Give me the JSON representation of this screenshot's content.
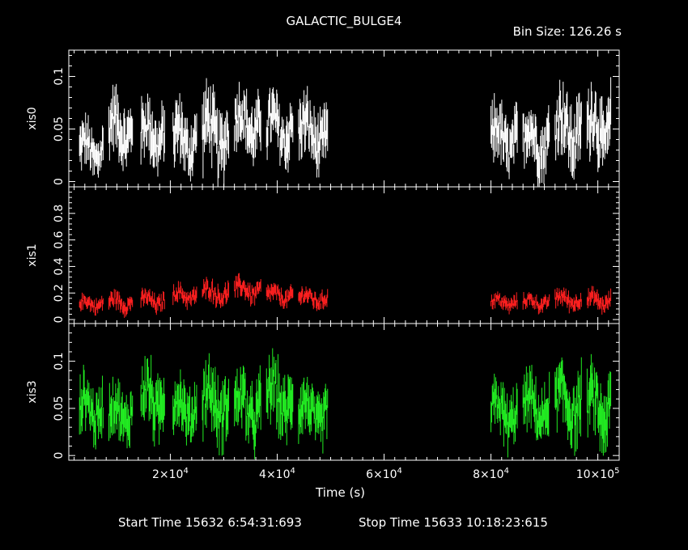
{
  "header": {
    "title": "GALACTIC_BULGE4",
    "bin_size": "Bin Size: 126.26 s"
  },
  "footer": {
    "start_time": "Start Time 15632  6:54:31:693",
    "stop_time": "Stop Time 15633 10:18:23:615"
  },
  "colors": {
    "xis0": "#ffffff",
    "xis1": "#ff2020",
    "xis3": "#22ee22",
    "axis": "#ffffff",
    "background": "#000000"
  },
  "chart_data": {
    "type": "scatter",
    "xlabel": "Time (s)",
    "xlim": [
      1000,
      104000
    ],
    "x_ticks": [
      {
        "value": 20000,
        "mant": "2",
        "exp": "4"
      },
      {
        "value": 40000,
        "mant": "4",
        "exp": "4"
      },
      {
        "value": 60000,
        "mant": "6",
        "exp": "4"
      },
      {
        "value": 80000,
        "mant": "8",
        "exp": "4"
      },
      {
        "value": 100000,
        "mant": "10",
        "exp": "5"
      }
    ],
    "panels": [
      {
        "name": "xis0",
        "ylabel": "xis0",
        "color": "#ffffff",
        "ylim": [
          -0.005,
          0.125
        ],
        "yticks": [
          {
            "v": 0,
            "t": "0"
          },
          {
            "v": 0.05,
            "t": "0.05"
          },
          {
            "v": 0.1,
            "t": "0.1"
          }
        ],
        "segments": [
          {
            "start": 3000,
            "end": 7500,
            "mean": 0.03,
            "amp": 0.02
          },
          {
            "start": 8500,
            "end": 13000,
            "mean": 0.05,
            "amp": 0.025
          },
          {
            "start": 14500,
            "end": 19000,
            "mean": 0.045,
            "amp": 0.025
          },
          {
            "start": 20500,
            "end": 25000,
            "mean": 0.04,
            "amp": 0.025
          },
          {
            "start": 26000,
            "end": 31000,
            "mean": 0.045,
            "amp": 0.03
          },
          {
            "start": 32000,
            "end": 37000,
            "mean": 0.055,
            "amp": 0.025
          },
          {
            "start": 38000,
            "end": 43000,
            "mean": 0.05,
            "amp": 0.025
          },
          {
            "start": 44000,
            "end": 49500,
            "mean": 0.045,
            "amp": 0.025
          },
          {
            "start": 80000,
            "end": 85000,
            "mean": 0.04,
            "amp": 0.025
          },
          {
            "start": 86000,
            "end": 91000,
            "mean": 0.04,
            "amp": 0.025
          },
          {
            "start": 92000,
            "end": 97000,
            "mean": 0.05,
            "amp": 0.03
          },
          {
            "start": 98000,
            "end": 102500,
            "mean": 0.05,
            "amp": 0.03
          }
        ]
      },
      {
        "name": "xis1",
        "ylabel": "xis1",
        "color": "#ff2020",
        "ylim": [
          -0.03,
          1.0
        ],
        "yticks": [
          {
            "v": 0,
            "t": "0"
          },
          {
            "v": 0.2,
            "t": "0.2"
          },
          {
            "v": 0.4,
            "t": "0.4"
          },
          {
            "v": 0.6,
            "t": "0.6"
          },
          {
            "v": 0.8,
            "t": "0.8"
          }
        ],
        "segments": [
          {
            "start": 3000,
            "end": 7500,
            "mean": 0.12,
            "amp": 0.05
          },
          {
            "start": 8500,
            "end": 13000,
            "mean": 0.13,
            "amp": 0.06
          },
          {
            "start": 14500,
            "end": 19000,
            "mean": 0.14,
            "amp": 0.06
          },
          {
            "start": 20500,
            "end": 25000,
            "mean": 0.18,
            "amp": 0.06
          },
          {
            "start": 26000,
            "end": 31000,
            "mean": 0.2,
            "amp": 0.07
          },
          {
            "start": 32000,
            "end": 37000,
            "mean": 0.22,
            "amp": 0.07
          },
          {
            "start": 38000,
            "end": 43000,
            "mean": 0.18,
            "amp": 0.06
          },
          {
            "start": 44000,
            "end": 49500,
            "mean": 0.16,
            "amp": 0.06
          },
          {
            "start": 80000,
            "end": 85000,
            "mean": 0.13,
            "amp": 0.05
          },
          {
            "start": 86000,
            "end": 91000,
            "mean": 0.13,
            "amp": 0.05
          },
          {
            "start": 92000,
            "end": 97000,
            "mean": 0.15,
            "amp": 0.06
          },
          {
            "start": 98000,
            "end": 102500,
            "mean": 0.14,
            "amp": 0.06
          }
        ]
      },
      {
        "name": "xis3",
        "ylabel": "xis3",
        "color": "#22ee22",
        "ylim": [
          -0.005,
          0.14
        ],
        "yticks": [
          {
            "v": 0,
            "t": "0"
          },
          {
            "v": 0.05,
            "t": "0.05"
          },
          {
            "v": 0.1,
            "t": "0.1"
          }
        ],
        "segments": [
          {
            "start": 3000,
            "end": 7500,
            "mean": 0.05,
            "amp": 0.025
          },
          {
            "start": 8500,
            "end": 13000,
            "mean": 0.045,
            "amp": 0.025
          },
          {
            "start": 14500,
            "end": 19000,
            "mean": 0.06,
            "amp": 0.03
          },
          {
            "start": 20500,
            "end": 25000,
            "mean": 0.05,
            "amp": 0.025
          },
          {
            "start": 26000,
            "end": 31000,
            "mean": 0.055,
            "amp": 0.03
          },
          {
            "start": 32000,
            "end": 37000,
            "mean": 0.05,
            "amp": 0.03
          },
          {
            "start": 38000,
            "end": 43000,
            "mean": 0.06,
            "amp": 0.03
          },
          {
            "start": 44000,
            "end": 49500,
            "mean": 0.045,
            "amp": 0.025
          },
          {
            "start": 80000,
            "end": 85000,
            "mean": 0.045,
            "amp": 0.025
          },
          {
            "start": 86000,
            "end": 91000,
            "mean": 0.05,
            "amp": 0.025
          },
          {
            "start": 92000,
            "end": 97000,
            "mean": 0.055,
            "amp": 0.03
          },
          {
            "start": 98000,
            "end": 102500,
            "mean": 0.05,
            "amp": 0.03
          }
        ]
      }
    ]
  }
}
